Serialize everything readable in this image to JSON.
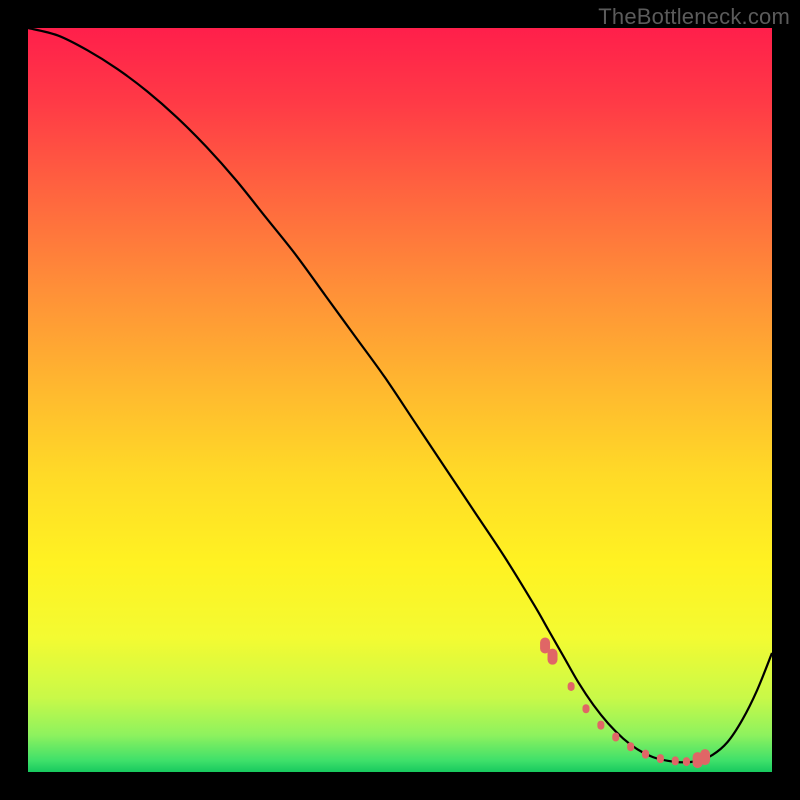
{
  "watermark": "TheBottleneck.com",
  "chart_data": {
    "type": "line",
    "title": "",
    "xlabel": "",
    "ylabel": "",
    "xlim": [
      0,
      100
    ],
    "ylim": [
      0,
      100
    ],
    "grid": false,
    "legend": false,
    "series": [
      {
        "name": "curve",
        "x": [
          0,
          4,
          8,
          12,
          16,
          20,
          24,
          28,
          32,
          36,
          40,
          44,
          48,
          52,
          56,
          60,
          64,
          68,
          70,
          72,
          74,
          76,
          78,
          80,
          82,
          84,
          86,
          88,
          90,
          92,
          94,
          96,
          98,
          100
        ],
        "y": [
          100,
          99,
          97,
          94.5,
          91.5,
          88,
          84,
          79.5,
          74.5,
          69.5,
          64,
          58.5,
          53,
          47,
          41,
          35,
          29,
          22.5,
          19,
          15.5,
          12,
          9,
          6.5,
          4.5,
          3,
          2,
          1.5,
          1.3,
          1.5,
          2.3,
          4,
          7,
          11,
          16
        ]
      }
    ],
    "markers": {
      "name": "highlight-points",
      "color": "#e06666",
      "x": [
        69.5,
        70.5,
        73,
        75,
        77,
        79,
        81,
        83,
        85,
        87,
        88.5,
        90,
        91
      ],
      "y": [
        17,
        15.5,
        11.5,
        8.5,
        6.3,
        4.7,
        3.4,
        2.4,
        1.8,
        1.5,
        1.4,
        1.6,
        2.0
      ]
    },
    "gradient_stops": [
      {
        "offset": 0.0,
        "color": "#ff1f4b"
      },
      {
        "offset": 0.1,
        "color": "#ff3a46"
      },
      {
        "offset": 0.22,
        "color": "#ff643f"
      },
      {
        "offset": 0.35,
        "color": "#ff8f38"
      },
      {
        "offset": 0.48,
        "color": "#ffb72f"
      },
      {
        "offset": 0.6,
        "color": "#ffda27"
      },
      {
        "offset": 0.72,
        "color": "#fff222"
      },
      {
        "offset": 0.82,
        "color": "#f3fb32"
      },
      {
        "offset": 0.9,
        "color": "#c9f948"
      },
      {
        "offset": 0.95,
        "color": "#8ef25e"
      },
      {
        "offset": 0.985,
        "color": "#3ee06a"
      },
      {
        "offset": 1.0,
        "color": "#17c95f"
      }
    ]
  }
}
